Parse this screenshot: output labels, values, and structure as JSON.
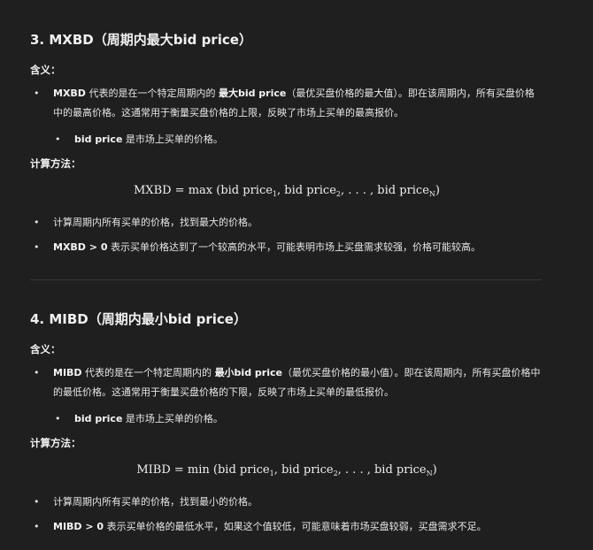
{
  "sec1": {
    "title": "3. MXBD（周期内最大bid price）",
    "meaning_label": "含义：",
    "b1_a": "MXBD",
    "b1_b": " 代表的是在一个特定周期内的 ",
    "b1_c": "最大bid price",
    "b1_d": "（最优买盘价格的最大值）。即在该周期内，所有买盘价格中的最高价格。这通常用于衡量买盘价格的上限，反映了市场上买单的最高报价。",
    "sub_a": "bid price",
    "sub_b": " 是市场上买单的价格。",
    "calc_label": "计算方法：",
    "f_lhs": "MXBD",
    "f_mid": " = max (bid price",
    "f_s1": "1",
    "f_c1": ", bid price",
    "f_s2": "2",
    "f_c2": ", . . . , bid price",
    "f_sN": "N",
    "f_end": ")",
    "c1": "计算周期内所有买单的价格，找到最大的价格。",
    "c2_a": "MXBD > 0",
    "c2_b": " 表示买单价格达到了一个较高的水平，可能表明市场上买盘需求较强，价格可能较高。"
  },
  "sec2": {
    "title": "4. MIBD（周期内最小bid price）",
    "meaning_label": "含义：",
    "b1_a": "MIBD",
    "b1_b": " 代表的是在一个特定周期内的 ",
    "b1_c": "最小bid price",
    "b1_d": "（最优买盘价格的最小值）。即在该周期内，所有买盘价格中的最低价格。这通常用于衡量买盘价格的下限，反映了市场上买单的最低报价。",
    "sub_a": "bid price",
    "sub_b": " 是市场上买单的价格。",
    "calc_label": "计算方法：",
    "f_lhs": "MIBD",
    "f_mid": " = min (bid price",
    "f_s1": "1",
    "f_c1": ", bid price",
    "f_s2": "2",
    "f_c2": ", . . . , bid price",
    "f_sN": "N",
    "f_end": ")",
    "c1": "计算周期内所有买单的价格，找到最小的价格。",
    "c2_a": "MIBD > 0",
    "c2_b": " 表示买单价格的最低水平，如果这个值较低，可能意味着市场买盘较弱，买盘需求不足。"
  }
}
